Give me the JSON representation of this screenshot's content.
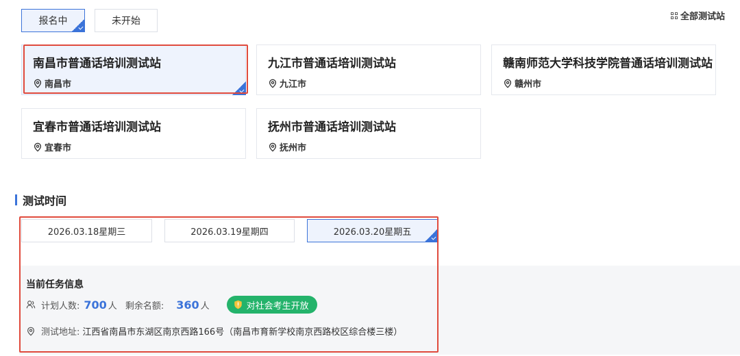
{
  "tabs": [
    {
      "label": "报名中",
      "active": true
    },
    {
      "label": "未开始",
      "active": false
    }
  ],
  "all_stations_label": "全部测试站",
  "stations": [
    {
      "name": "南昌市普通话培训测试站",
      "city": "南昌市",
      "selected": true
    },
    {
      "name": "九江市普通话培训测试站",
      "city": "九江市",
      "selected": false
    },
    {
      "name": "赣南师范大学科技学院普通话培训测试站",
      "city": "赣州市",
      "selected": false
    },
    {
      "name": "宜春市普通话培训测试站",
      "city": "宜春市",
      "selected": false
    },
    {
      "name": "抚州市普通话培训测试站",
      "city": "抚州市",
      "selected": false
    }
  ],
  "test_time": {
    "title": "测试时间",
    "dates": [
      {
        "label": "2026.03.18星期三",
        "selected": false
      },
      {
        "label": "2026.03.19星期四",
        "selected": false
      },
      {
        "label": "2026.03.20星期五",
        "selected": true
      }
    ]
  },
  "task_info": {
    "title": "当前任务信息",
    "planned_label": "计划人数:",
    "planned_value": "700",
    "planned_unit": "人",
    "remaining_label": "剩余名额:",
    "remaining_value": "360",
    "remaining_unit": "人",
    "open_badge": "对社会考生开放",
    "address_label": "测试地址:",
    "address": "江西省南昌市东湖区南京西路166号（南昌市育新学校南京西路校区综合楼三楼）"
  },
  "colors": {
    "accent": "#3b73d9",
    "highlight_border": "#e04a3c",
    "badge_green": "#24b36b"
  }
}
